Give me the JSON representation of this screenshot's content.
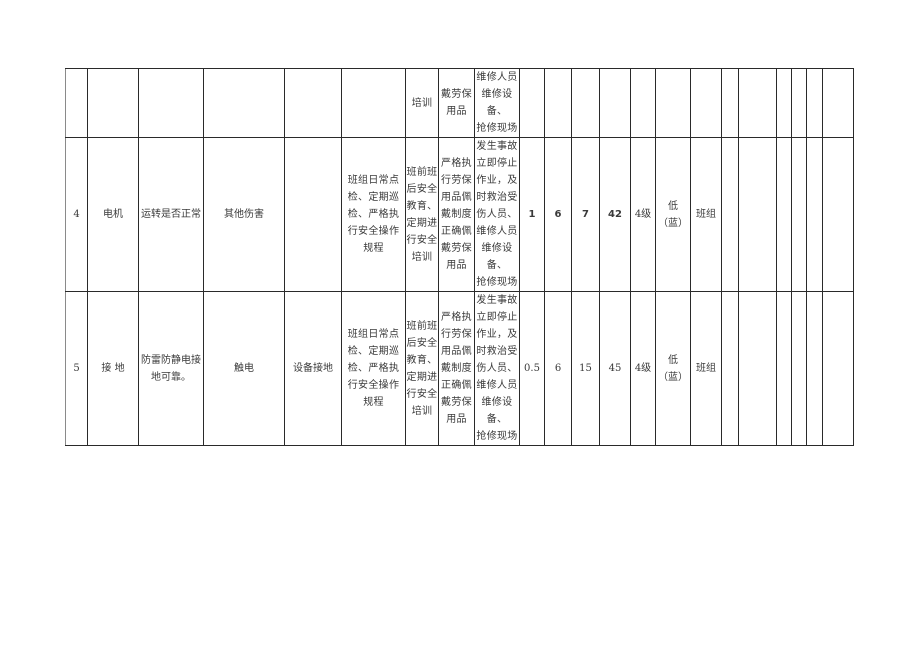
{
  "table": {
    "partial_row": {
      "c6_training": [
        "培训"
      ],
      "c7_ppe": [
        "戴劳保",
        "用品"
      ],
      "c8_emergency": [
        "维修人员",
        "维修设备、",
        "抢修现场"
      ]
    },
    "rows": [
      {
        "no": "4",
        "equipment": "电机",
        "check_item": "运转是否正常",
        "hazard": "其他伤害",
        "engineering": "",
        "management": [
          "班组日常点",
          "检、定期巡",
          "检、严格执",
          "行安全操作",
          "规程"
        ],
        "training": [
          "班前班",
          "后安全",
          "教育、",
          "定期进",
          "行安全",
          "培训"
        ],
        "ppe": [
          "严格执",
          "行劳保",
          "用品佩",
          "戴制度",
          "正确佩",
          "戴劳保",
          "用品"
        ],
        "emergency": [
          "发生事故",
          "立即停止",
          "作业，及",
          "时救治受",
          "伤人员、",
          "维修人员",
          "维修设备、",
          "抢修现场"
        ],
        "L": "1",
        "E": "6",
        "C": "7",
        "D": "42",
        "level": "4级",
        "grade": "低（蓝）",
        "control_level": "班组"
      },
      {
        "no": "5",
        "equipment": "接 地",
        "check_item": "防雷防静电接地可靠。",
        "hazard": "触电",
        "engineering": "设备接地",
        "management": [
          "班组日常点",
          "检、定期巡",
          "检、严格执",
          "行安全操作",
          "规程"
        ],
        "training": [
          "班前班",
          "后安全",
          "教育、",
          "定期进",
          "行安全",
          "培训"
        ],
        "ppe": [
          "严格执",
          "行劳保",
          "用品佩",
          "戴制度",
          "正确佩",
          "戴劳保",
          "用品"
        ],
        "emergency": [
          "发生事故",
          "立即停止",
          "作业，及",
          "时救治受",
          "伤人员、",
          "维修人员",
          "维修设备、",
          "抢修现场"
        ],
        "L": "0.5",
        "E": "6",
        "C": "15",
        "D": "45",
        "level": "4级",
        "grade": "低（蓝）",
        "control_level": "班组"
      }
    ]
  }
}
